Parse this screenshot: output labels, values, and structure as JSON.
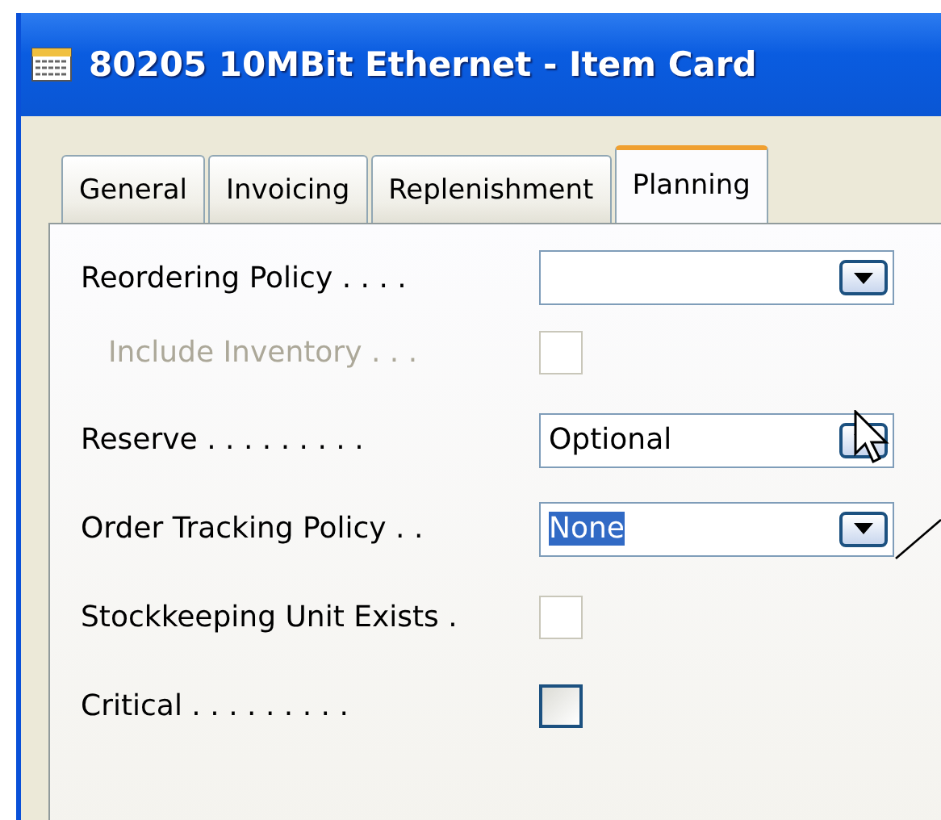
{
  "window": {
    "title": "80205 10MBit Ethernet - Item Card"
  },
  "tabs": [
    {
      "label": "General",
      "selected": false
    },
    {
      "label": "Invoicing",
      "selected": false
    },
    {
      "label": "Replenishment",
      "selected": false
    },
    {
      "label": "Planning",
      "selected": true
    }
  ],
  "fields": [
    {
      "kind": "dropdown",
      "label": "Reordering Policy . . . .",
      "disabled": false
    },
    {
      "kind": "checkbox",
      "label": "Include Inventory . . .",
      "disabled": true,
      "checked": false,
      "read_only": true,
      "indented": true
    },
    {
      "kind": "dropdown",
      "label": "Reserve . . . . . . . . .",
      "value": "Optional",
      "disabled": false,
      "text_selected": false
    },
    {
      "kind": "dropdown",
      "label": "Order Tracking Policy . .",
      "value": "None",
      "disabled": false,
      "text_selected": true
    },
    {
      "kind": "checkbox",
      "label": "Stockkeeping Unit Exists .",
      "disabled": false,
      "checked": false,
      "read_only": true
    },
    {
      "kind": "checkbox",
      "label": "Critical . . . . . . . . .",
      "disabled": false,
      "checked": false,
      "read_only": false
    }
  ]
}
